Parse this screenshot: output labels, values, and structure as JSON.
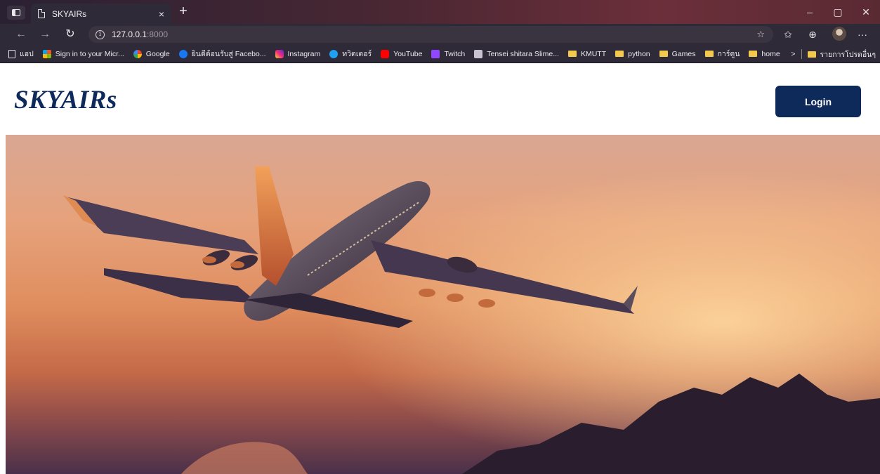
{
  "browser": {
    "tab_title": "SKYAIRs",
    "tab_close": "×",
    "new_tab": "+",
    "address_host": "127.0.0.1",
    "address_port": ":8000",
    "window_controls": [
      "–",
      "▢",
      "✕"
    ],
    "more": "···",
    "icons": [
      "sidebar-toggle-icon",
      "page-icon",
      "back-icon",
      "forward-icon",
      "refresh-icon",
      "info-icon",
      "favorite-icon",
      "favorites-icon",
      "collections-icon",
      "profile-icon"
    ]
  },
  "bookmarks": {
    "items": [
      {
        "label": "แอป",
        "icon": "page"
      },
      {
        "label": "Sign in to your Micr...",
        "icon": "microsoft"
      },
      {
        "label": "Google",
        "icon": "google"
      },
      {
        "label": "ยินดีต้อนรับสู่ Facebo...",
        "icon": "facebook"
      },
      {
        "label": "Instagram",
        "icon": "instagram"
      },
      {
        "label": "ทวิตเตอร์",
        "icon": "twitter"
      },
      {
        "label": "YouTube",
        "icon": "youtube"
      },
      {
        "label": "Twitch",
        "icon": "twitch"
      },
      {
        "label": "Tensei shitara Slime...",
        "icon": "anime"
      },
      {
        "label": "KMUTT",
        "icon": "folder"
      },
      {
        "label": "python",
        "icon": "folder"
      },
      {
        "label": "Games",
        "icon": "folder"
      },
      {
        "label": "การ์ตูน",
        "icon": "folder"
      },
      {
        "label": "home",
        "icon": "folder"
      }
    ],
    "overflow": ">",
    "other_favorites": "รายการโปรดอื่นๆ"
  },
  "site": {
    "logo": "SKYAIRs",
    "login_label": "Login",
    "brand_color": "#0e2a5a"
  }
}
